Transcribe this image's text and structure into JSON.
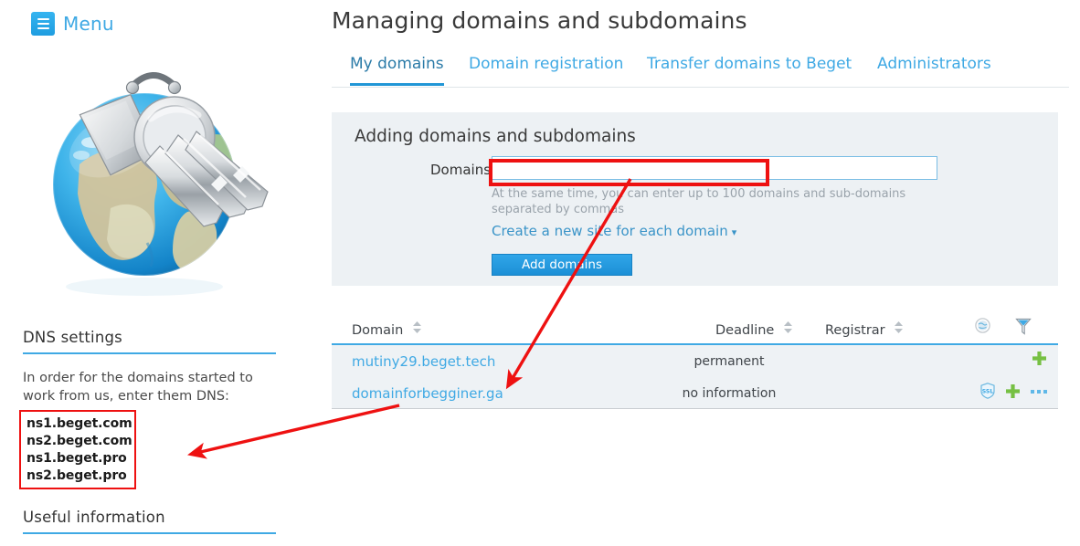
{
  "sidebar": {
    "menu_label": "Menu",
    "menu_icon": "hamburger-icon",
    "illustration": "globe-with-keys-image",
    "dns_heading": "DNS settings",
    "dns_text": "In order for the domains started to work from us, enter them DNS:",
    "nameservers": [
      "ns1.beget.com",
      "ns2.beget.com",
      "ns1.beget.pro",
      "ns2.beget.pro"
    ],
    "useful_heading": "Useful information"
  },
  "main": {
    "title": "Managing domains and subdomains",
    "tabs": [
      {
        "label": "My domains",
        "active": true
      },
      {
        "label": "Domain registration",
        "active": false
      },
      {
        "label": "Transfer domains to Beget",
        "active": false
      },
      {
        "label": "Administrators",
        "active": false
      }
    ],
    "panel": {
      "title": "Adding domains and subdomains",
      "field_label": "Domains:",
      "field_value": "",
      "field_placeholder": "",
      "hint": "At the same time, you can enter up to 100 domains and sub-domains separated by commas",
      "create_link": "Create a new site for each domain",
      "create_link_chevron": "chevron-down-icon",
      "submit_label": "Add domains"
    },
    "table": {
      "columns": [
        {
          "label": "Domain",
          "sortable": true
        },
        {
          "label": "Deadline",
          "sortable": true
        },
        {
          "label": "Registrar",
          "sortable": true
        }
      ],
      "header_icons": [
        "globe-icon",
        "filter-funnel-icon"
      ],
      "rows": [
        {
          "domain": "mutiny29.beget.tech",
          "deadline": "permanent",
          "registrar": "",
          "icons": [
            "add-plus-icon"
          ]
        },
        {
          "domain": "domainforbegginer.ga",
          "deadline": "no information",
          "registrar": "",
          "icons": [
            "ssl-shield-icon",
            "add-plus-icon",
            "more-options-icon"
          ]
        }
      ]
    }
  },
  "annotations": {
    "highlight_box_color": "#ee1111",
    "arrow_color": "#ee1111",
    "boxes": [
      "domains-input-highlight",
      "nameservers-highlight"
    ],
    "arrows": [
      "arrow-to-domainforbegginer",
      "arrow-to-nameservers"
    ]
  },
  "colors": {
    "accent_blue": "#3fa9e4",
    "button_blue": "#1c8fd6",
    "panel_bg": "#edf1f4",
    "row_bg": "#eef2f5",
    "plus_green": "#76c043",
    "annotation_red": "#ee1111"
  }
}
